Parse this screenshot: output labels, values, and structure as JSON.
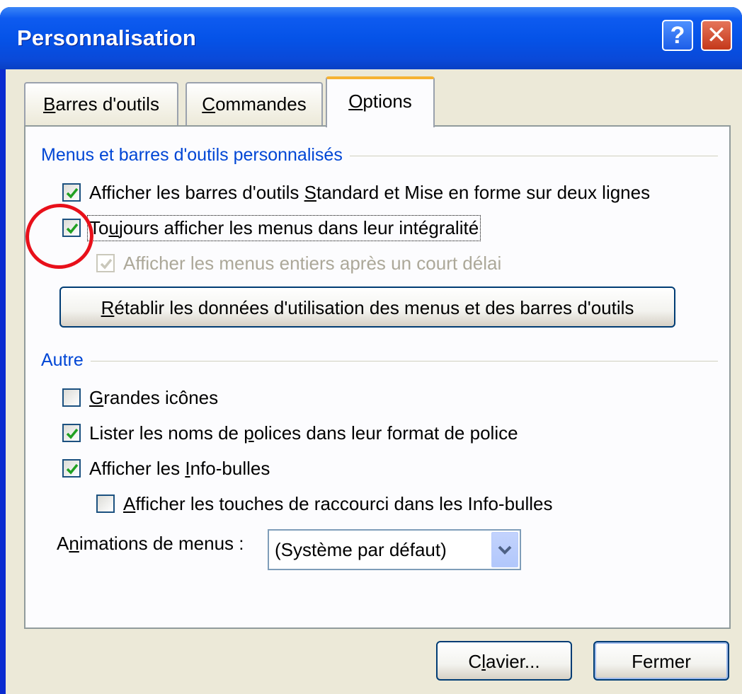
{
  "window": {
    "title": "Personnalisation",
    "help_label": "?",
    "close_label": "✕"
  },
  "tabs": [
    {
      "label": "Barres d'outils",
      "mnemonic": "B",
      "rest": "arres d'outils",
      "active": false
    },
    {
      "label": "Commandes",
      "mnemonic": "C",
      "rest": "ommandes",
      "active": false
    },
    {
      "label": "Options",
      "mnemonic": "O",
      "rest": "ptions",
      "active": true
    }
  ],
  "groups": {
    "menus": {
      "title": "Menus et barres d'outils personnalisés",
      "options": [
        {
          "pre": "Afficher les barres d'outils ",
          "mnemonic": "S",
          "post": "tandard et Mise en forme sur deux lignes",
          "label": "Afficher les barres d'outils Standard et Mise en forme sur deux lignes",
          "checked": true,
          "enabled": true
        },
        {
          "pre": "To",
          "mnemonic": "u",
          "post": "jours afficher les menus dans leur intégralité",
          "label": "Toujours afficher les menus dans leur intégralité",
          "checked": true,
          "enabled": true,
          "focused": true
        },
        {
          "pre": "Afficher les menus entiers après un court délai",
          "mnemonic": "",
          "post": "",
          "label": "Afficher les menus entiers après un court délai",
          "checked": true,
          "enabled": false
        }
      ],
      "reset_button": {
        "mnemonic": "R",
        "rest": "établir les données d'utilisation des menus et des barres d'outils",
        "label": "Rétablir les données d'utilisation des menus et des barres d'outils"
      }
    },
    "autre": {
      "title": "Autre",
      "options": [
        {
          "pre": "",
          "mnemonic": "G",
          "post": "randes icônes",
          "label": "Grandes icônes",
          "checked": false,
          "enabled": true
        },
        {
          "pre": "Lister les noms de ",
          "mnemonic": "p",
          "post": "olices dans leur format de police",
          "label": "Lister les noms de polices dans leur format de police",
          "checked": true,
          "enabled": true
        },
        {
          "pre": "Afficher les ",
          "mnemonic": "I",
          "post": "nfo-bulles",
          "label": "Afficher les Info-bulles",
          "checked": true,
          "enabled": true
        },
        {
          "pre": "",
          "mnemonic": "A",
          "post": "fficher les touches de raccourci dans les Info-bulles",
          "label": "Afficher les touches de raccourci dans les Info-bulles",
          "checked": false,
          "enabled": true
        }
      ],
      "animations": {
        "label_pre": "A",
        "label_mnemonic": "n",
        "label_post": "imations de menus :",
        "label": "Animations de menus :",
        "value": "(Système par défaut)"
      }
    }
  },
  "footer": {
    "keyboard_button": {
      "pre": "C",
      "mnemonic": "l",
      "post": "avier...",
      "label": "Clavier..."
    },
    "close_button": "Fermer"
  },
  "colors": {
    "titlebar": "#0553e8",
    "group_title": "#0046d5",
    "checkmark": "#21a121",
    "annotation_circle": "#e8101a",
    "active_tab_accent": "#f6b333"
  },
  "icons": {
    "help": "help-icon",
    "close": "close-icon",
    "check": "checkmark-icon",
    "dropdown": "chevron-down-icon"
  }
}
